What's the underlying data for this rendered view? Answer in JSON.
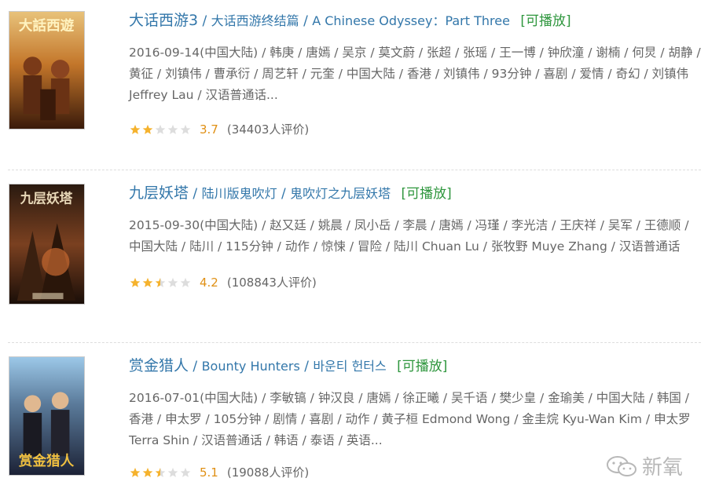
{
  "movies": [
    {
      "title": "大话西游3",
      "aka_cn": "大话西游终结篇",
      "aka_en": "A Chinese Odyssey：Part Three",
      "playable": "[可播放]",
      "meta": "2016-09-14(中国大陆) / 韩庚 / 唐嫣 / 吴京 / 莫文蔚 / 张超 / 张瑶 / 王一博 / 钟欣潼 / 谢楠 / 何炅 / 胡静 / 黄征 / 刘镇伟 / 曹承衍 / 周艺轩 / 元奎 / 中国大陆 / 香港 / 刘镇伟 / 93分钟 / 喜剧 / 爱情 / 奇幻 / 刘镇伟 Jeffrey Lau / 汉语普通话...",
      "score": "3.7",
      "votes": "(34403人评价)",
      "stars_filled": 2.0,
      "poster_colors": [
        "#5a2a12",
        "#c3762a",
        "#e8c27a"
      ]
    },
    {
      "title": "九层妖塔",
      "aka_cn": "陆川版鬼吹灯",
      "aka_en": "鬼吹灯之九层妖塔",
      "playable": "[可播放]",
      "meta": "2015-09-30(中国大陆) / 赵又廷 / 姚晨 / 凤小岳 / 李晨 / 唐嫣 / 冯瑾 / 李光洁 / 王庆祥 / 吴军 / 王德顺 / 中国大陆 / 陆川 / 115分钟 / 动作 / 惊悚 / 冒险 / 陆川 Chuan Lu / 张牧野 Muye Zhang / 汉语普通话",
      "score": "4.2",
      "votes": "(108843人评价)",
      "stars_filled": 2.5,
      "poster_colors": [
        "#2a1a10",
        "#7a4020",
        "#c86a30"
      ]
    },
    {
      "title": "赏金猎人",
      "aka_cn": "Bounty Hunters",
      "aka_en": "바운티 헌터스",
      "playable": "[可播放]",
      "meta": "2016-07-01(中国大陆) / 李敏镐 / 钟汉良 / 唐嫣 / 徐正曦 / 吴千语 / 樊少皇 / 金瑜美 / 中国大陆 / 韩国 / 香港 / 申太罗 / 105分钟 / 剧情 / 喜剧 / 动作 / 黄子桓 Edmond Wong / 金圭烷 Kyu-Wan Kim / 申太罗 Terra Shin / 汉语普通话 / 韩语 / 泰语 / 英语...",
      "score": "5.1",
      "votes": "(19088人评价)",
      "stars_filled": 2.5,
      "poster_colors": [
        "#9cc8e8",
        "#1c2236",
        "#f0c040"
      ]
    }
  ],
  "watermark": {
    "text": "新氧",
    "icon": "wechat-icon"
  },
  "colors": {
    "link": "#3377aa",
    "playable": "#2e963d",
    "score": "#e09015",
    "star": "#f5b22d",
    "star_empty": "#dddddd"
  }
}
